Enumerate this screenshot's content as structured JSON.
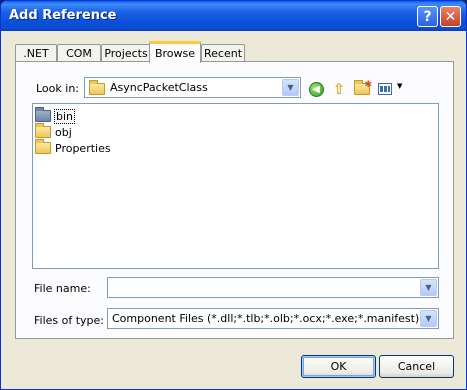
{
  "window": {
    "title": "Add Reference",
    "help_label": "?",
    "close_label": "✕"
  },
  "tabs": [
    {
      "label": ".NET"
    },
    {
      "label": "COM"
    },
    {
      "label": "Projects"
    },
    {
      "label": "Browse",
      "active": true
    },
    {
      "label": "Recent"
    }
  ],
  "browse": {
    "look_in_label": "Look in:",
    "look_in_value": "AsyncPacketClass",
    "toolbar_icons": [
      "back-icon",
      "up-folder-icon",
      "new-folder-icon",
      "views-menu-icon"
    ],
    "files": [
      {
        "name": "bin",
        "selected": true
      },
      {
        "name": "obj",
        "selected": false
      },
      {
        "name": "Properties",
        "selected": false
      }
    ],
    "file_name_label": "File name:",
    "file_name_value": "",
    "files_of_type_label": "Files of type:",
    "files_of_type_value": "Component Files (*.dll;*.tlb;*.olb;*.ocx;*.exe;*.manifest)"
  },
  "buttons": {
    "ok": "OK",
    "cancel": "Cancel"
  },
  "colors": {
    "titlebar": "#0b4fd8",
    "dialog_bg": "#ece9d8",
    "active_tab_accent": "#ffc83c"
  }
}
